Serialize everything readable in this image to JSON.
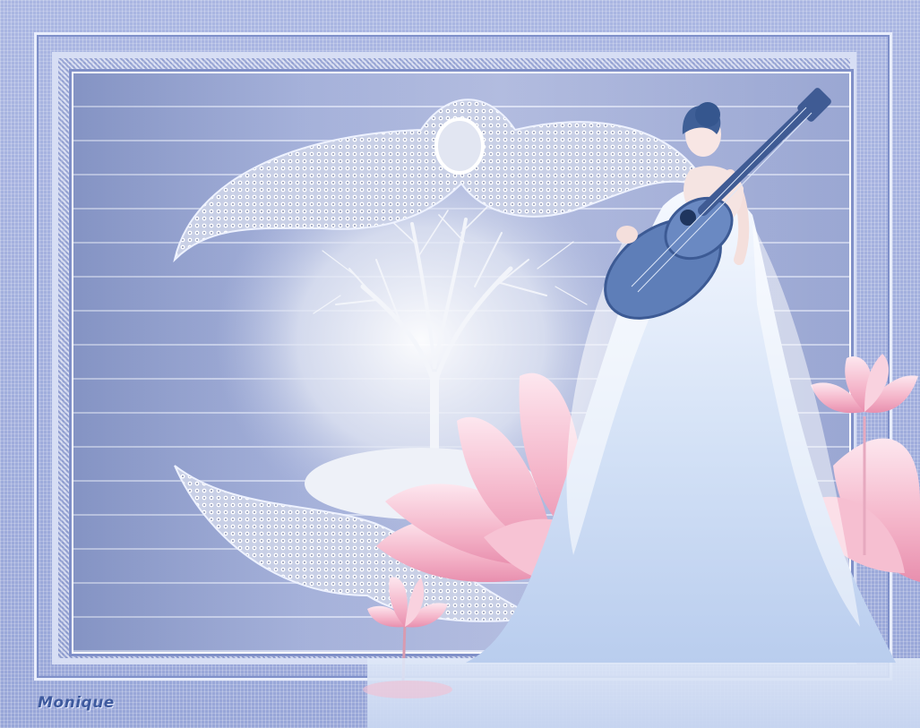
{
  "artwork": {
    "signature": "Monique",
    "colors": {
      "background": "#a9b4de",
      "frame_light": "#e9eefc",
      "frame_dark": "#7f90c9",
      "lotus_pink": "#f4b3c8",
      "dress_blue": "#d3e1f6",
      "guitar_blue": "#5e7eb8",
      "tree_white": "#f2f4f8"
    },
    "elements": [
      "outer-frame",
      "glitter-frame",
      "jewel-wing-top",
      "jewel-wing-bottom",
      "winter-tree",
      "lotus-flowers",
      "woman-with-guitar",
      "water-reflection"
    ]
  }
}
